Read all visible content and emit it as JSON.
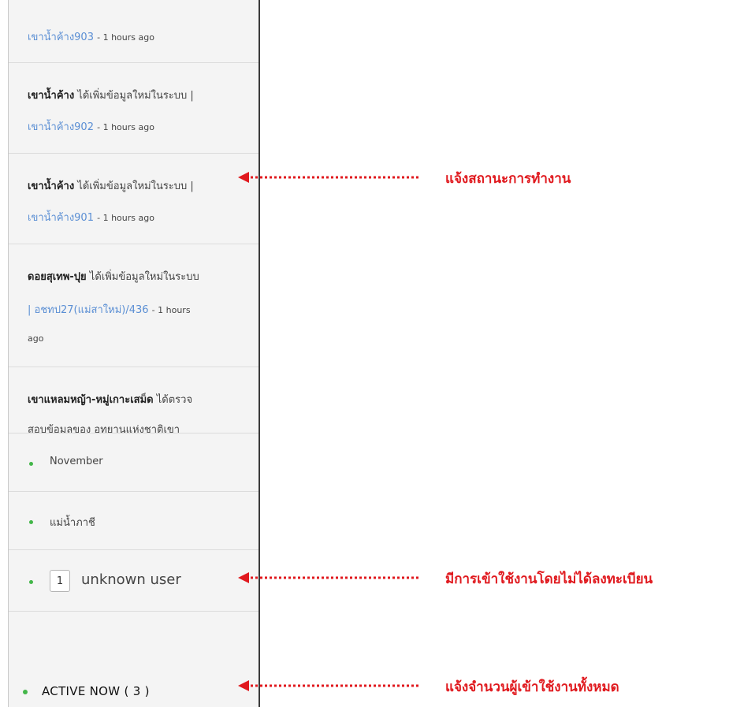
{
  "feed": {
    "items": [
      {
        "name": "",
        "desc": "",
        "link": "เขาน้ำค้าง903",
        "time": "- 1 hours ago"
      },
      {
        "name": "เขาน้ำค้าง",
        "desc": "ได้เพิ่มข้อมูลใหม่ในระบบ |",
        "link": "เขาน้ำค้าง902",
        "time": "- 1 hours ago"
      },
      {
        "name": "เขาน้ำค้าง",
        "desc": "ได้เพิ่มข้อมูลใหม่ในระบบ |",
        "link": "เขาน้ำค้าง901",
        "time": "- 1 hours ago"
      },
      {
        "name": "ดอยสุเทพ-ปุย",
        "desc": "ได้เพิ่มข้อมูลใหม่ในระบบ",
        "link_prefix": "|",
        "link": "อชทป27(แม่สาใหม่)/436",
        "time": "- 1 hours",
        "time2": "ago"
      },
      {
        "name": "เขาแหลมหญ้า-หมู่เกาะเสม็ด",
        "desc": "ได้ตรวจ",
        "line2": "สอบข้อมูลของ อุทยานแห่งชาติเขา"
      }
    ]
  },
  "list": {
    "items": [
      {
        "label": "November"
      },
      {
        "label": "แม่น้ำภาชี"
      }
    ],
    "unknown": {
      "count": "1",
      "label": "unknown user"
    },
    "active": {
      "label": "ACTIVE NOW ( 3 )"
    }
  },
  "annotations": [
    {
      "text": "แจ้งสถานะการทำงาน"
    },
    {
      "text": "มีการเข้าใช้งานโดยไม่ได้ลงทะเบียน"
    },
    {
      "text": "แจ้งจำนวนผู้เข้าใช้งานทั้งหมด"
    }
  ],
  "colors": {
    "annotation": "#e0191e",
    "link": "#5b8fd4",
    "online_dot": "#43b649",
    "panel_bg": "#f4f4f4"
  }
}
